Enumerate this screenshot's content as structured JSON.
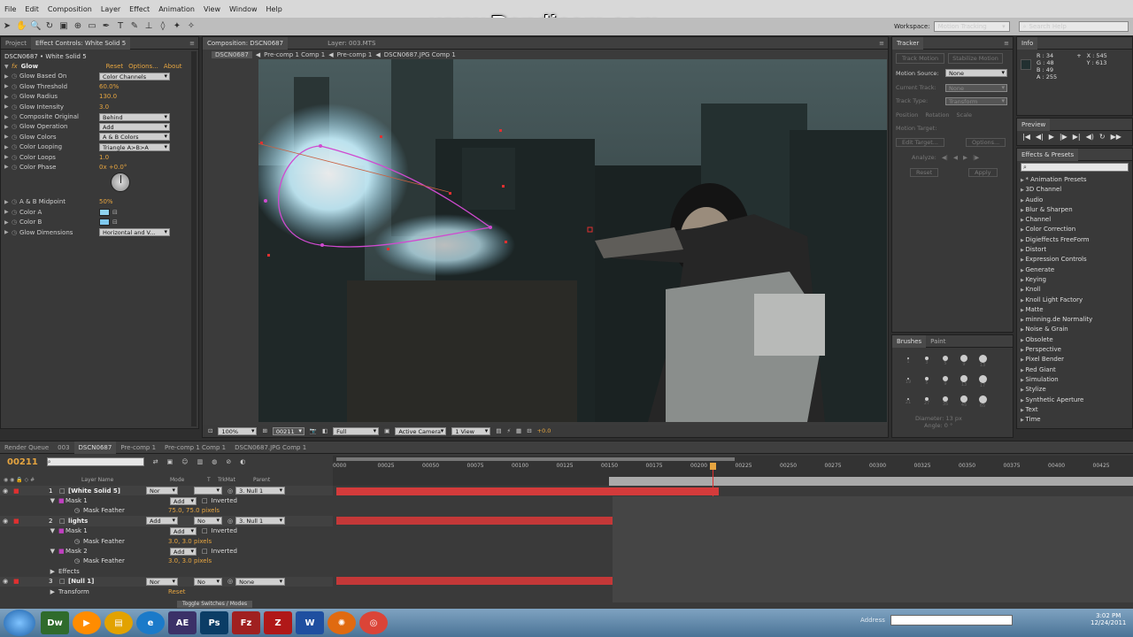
{
  "menu": [
    "File",
    "Edit",
    "Composition",
    "Layer",
    "Effect",
    "Animation",
    "View",
    "Window",
    "Help"
  ],
  "watermark": "www.Bandicam.com",
  "workspace": {
    "label": "Workspace:",
    "value": "Motion Tracking",
    "search_placeholder": "Search Help"
  },
  "project_tabs": {
    "project": "Project",
    "effect_controls": "Effect Controls: White Solid 5"
  },
  "effect_controls": {
    "layer_path": "DSCN0687 • White Solid 5",
    "effect_name": "Glow",
    "reset": "Reset",
    "options": "Options...",
    "about": "About",
    "props": [
      {
        "name": "Glow Based On",
        "value": "Color Channels",
        "type": "dd"
      },
      {
        "name": "Glow Threshold",
        "value": "60.0%",
        "type": "val"
      },
      {
        "name": "Glow Radius",
        "value": "130.0",
        "type": "val"
      },
      {
        "name": "Glow Intensity",
        "value": "3.0",
        "type": "val"
      },
      {
        "name": "Composite Original",
        "value": "Behind",
        "type": "dd"
      },
      {
        "name": "Glow Operation",
        "value": "Add",
        "type": "dd"
      },
      {
        "name": "Glow Colors",
        "value": "A & B Colors",
        "type": "dd"
      },
      {
        "name": "Color Looping",
        "value": "Triangle A>B>A",
        "type": "dd"
      },
      {
        "name": "Color Loops",
        "value": "1.0",
        "type": "val"
      },
      {
        "name": "Color Phase",
        "value": "0x +0.0°",
        "type": "val"
      }
    ],
    "props2": [
      {
        "name": "A & B Midpoint",
        "value": "50%",
        "type": "val"
      },
      {
        "name": "Color A",
        "value": "",
        "type": "color"
      },
      {
        "name": "Color B",
        "value": "",
        "type": "color"
      },
      {
        "name": "Glow Dimensions",
        "value": "Horizontal and V...",
        "type": "dd"
      }
    ],
    "color_a": "#8fd3f0",
    "color_b": "#7fc9ef"
  },
  "comp": {
    "tab": "Composition: DSCN0687",
    "layer_tab": "Layer: 003.MTS",
    "crumbs": [
      "DSCN0687",
      "Pre-comp 1 Comp 1",
      "Pre-comp 1",
      "DSCN0687.JPG Comp 1"
    ],
    "footer": {
      "zoom": "100%",
      "time": "00211",
      "res": "Full",
      "camera": "Active Camera",
      "view": "1 View",
      "exposure": "+0.0"
    }
  },
  "tracker": {
    "tab": "Tracker",
    "track_motion": "Track Motion",
    "stabilize": "Stabilize Motion",
    "motion_source_label": "Motion Source:",
    "motion_source": "None",
    "current_track_label": "Current Track:",
    "current_track": "None",
    "track_type_label": "Track Type:",
    "track_type": "Transform",
    "position": "Position",
    "rotation": "Rotation",
    "scale": "Scale",
    "motion_target": "Motion Target:",
    "edit_target": "Edit Target...",
    "options": "Options...",
    "analyze": "Analyze:",
    "reset": "Reset",
    "apply": "Apply"
  },
  "info": {
    "tab": "Info",
    "r": "R : 34",
    "g": "G : 48",
    "b": "B : 49",
    "a": "A : 255",
    "x": "X : 545",
    "y": "Y : 613"
  },
  "preview": {
    "tab": "Preview"
  },
  "effects_presets": {
    "tab": "Effects & Presets",
    "items": [
      "* Animation Presets",
      "3D Channel",
      "Audio",
      "Blur & Sharpen",
      "Channel",
      "Color Correction",
      "Digieffects FreeForm",
      "Distort",
      "Expression Controls",
      "Generate",
      "Keying",
      "Knoll",
      "Knoll Light Factory",
      "Matte",
      "minning.de Normality",
      "Noise & Grain",
      "Obsolete",
      "Perspective",
      "Pixel Bender",
      "Red Giant",
      "Simulation",
      "Stylize",
      "Synthetic Aperture",
      "Text",
      "Time"
    ]
  },
  "brushes": {
    "tabs": [
      "Brushes",
      "Paint"
    ],
    "sizes": [
      "1",
      "3",
      "5",
      "9",
      "13",
      "19",
      "5",
      "9",
      "13",
      "17",
      "21",
      "27",
      "35",
      "45",
      "65"
    ],
    "diameter": "Diameter: 13 px",
    "angle": "Angle: 0 °"
  },
  "timeline": {
    "tabs": [
      "Render Queue",
      "003",
      "DSCN0687",
      "Pre-comp 1",
      "Pre-comp 1 Comp 1",
      "DSCN0687.JPG Comp 1"
    ],
    "timecode": "00211",
    "col_headers": {
      "layer_name": "Layer Name",
      "mode": "Mode",
      "t": "T",
      "trkmat": "TrkMat",
      "parent": "Parent"
    },
    "ruler": [
      "0000",
      "00025",
      "00050",
      "00075",
      "00100",
      "00125",
      "00150",
      "00175",
      "00200",
      "00225",
      "00250",
      "00275",
      "00300",
      "00325",
      "00350",
      "00375",
      "00400",
      "00425"
    ],
    "rows": [
      {
        "num": "1",
        "name": "[White Solid 5]",
        "mode": "Nor",
        "parent": "3. Null 1",
        "kind": "layer"
      },
      {
        "name": "Mask 1",
        "mode": "Add",
        "inv": "Inverted",
        "kind": "mask"
      },
      {
        "name": "Mask Feather",
        "value": "75.0, 75.0 pixels",
        "kind": "prop"
      },
      {
        "num": "2",
        "name": "lights",
        "mode": "Add",
        "trk": "No",
        "parent": "3. Null 1",
        "kind": "layer"
      },
      {
        "name": "Mask 1",
        "mode": "Add",
        "inv": "Inverted",
        "kind": "mask"
      },
      {
        "name": "Mask Feather",
        "value": "3.0, 3.0 pixels",
        "kind": "prop"
      },
      {
        "name": "Mask 2",
        "mode": "Add",
        "inv": "Inverted",
        "kind": "mask"
      },
      {
        "name": "Mask Feather",
        "value": "3.0, 3.0 pixels",
        "kind": "prop"
      },
      {
        "name": "Effects",
        "kind": "group"
      },
      {
        "num": "3",
        "name": "[Null 1]",
        "mode": "Nor",
        "trk": "No",
        "parent": "None",
        "kind": "layer"
      },
      {
        "name": "Transform",
        "value": "Reset",
        "kind": "group"
      }
    ],
    "toggle": "Toggle Switches / Modes"
  },
  "taskbar": {
    "apps": [
      "Dw",
      "AE",
      "Ps",
      "W"
    ],
    "address": "Address",
    "time": "3:02 PM",
    "date": "12/24/2011"
  }
}
